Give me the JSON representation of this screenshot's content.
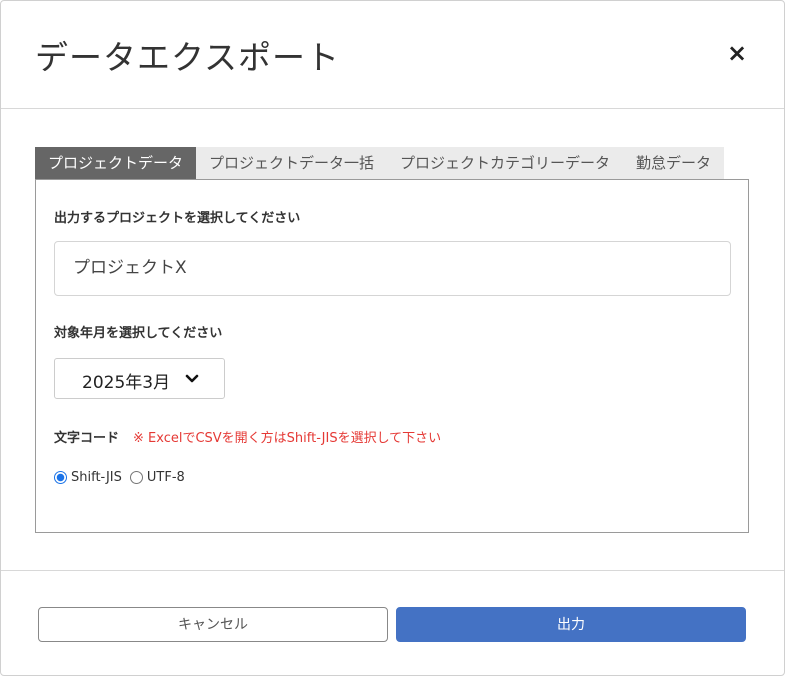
{
  "dialog": {
    "title": "データエクスポート",
    "close_label": "×"
  },
  "tabs": [
    {
      "label": "プロジェクトデータ",
      "active": true
    },
    {
      "label": "プロジェクトデータ一括",
      "active": false
    },
    {
      "label": "プロジェクトカテゴリーデータ",
      "active": false
    },
    {
      "label": "勤怠データ",
      "active": false
    }
  ],
  "form": {
    "project_label": "出力するプロジェクトを選択してください",
    "project_value": "プロジェクトX",
    "month_label": "対象年月を選択してください",
    "month_value": "2025年3月",
    "encoding_label": "文字コード",
    "encoding_note": "※ ExcelでCSVを開く方はShift-JISを選択して下さい",
    "encoding_options": [
      {
        "label": "Shift-JIS",
        "checked": true
      },
      {
        "label": "UTF-8",
        "checked": false
      }
    ]
  },
  "footer": {
    "cancel_label": "キャンセル",
    "submit_label": "出力"
  },
  "colors": {
    "active_tab": "#666666",
    "primary": "#4472c4",
    "note": "#e53935"
  },
  "icons": {
    "close": "close-icon",
    "select_chevron": "chevron-down-icon"
  }
}
